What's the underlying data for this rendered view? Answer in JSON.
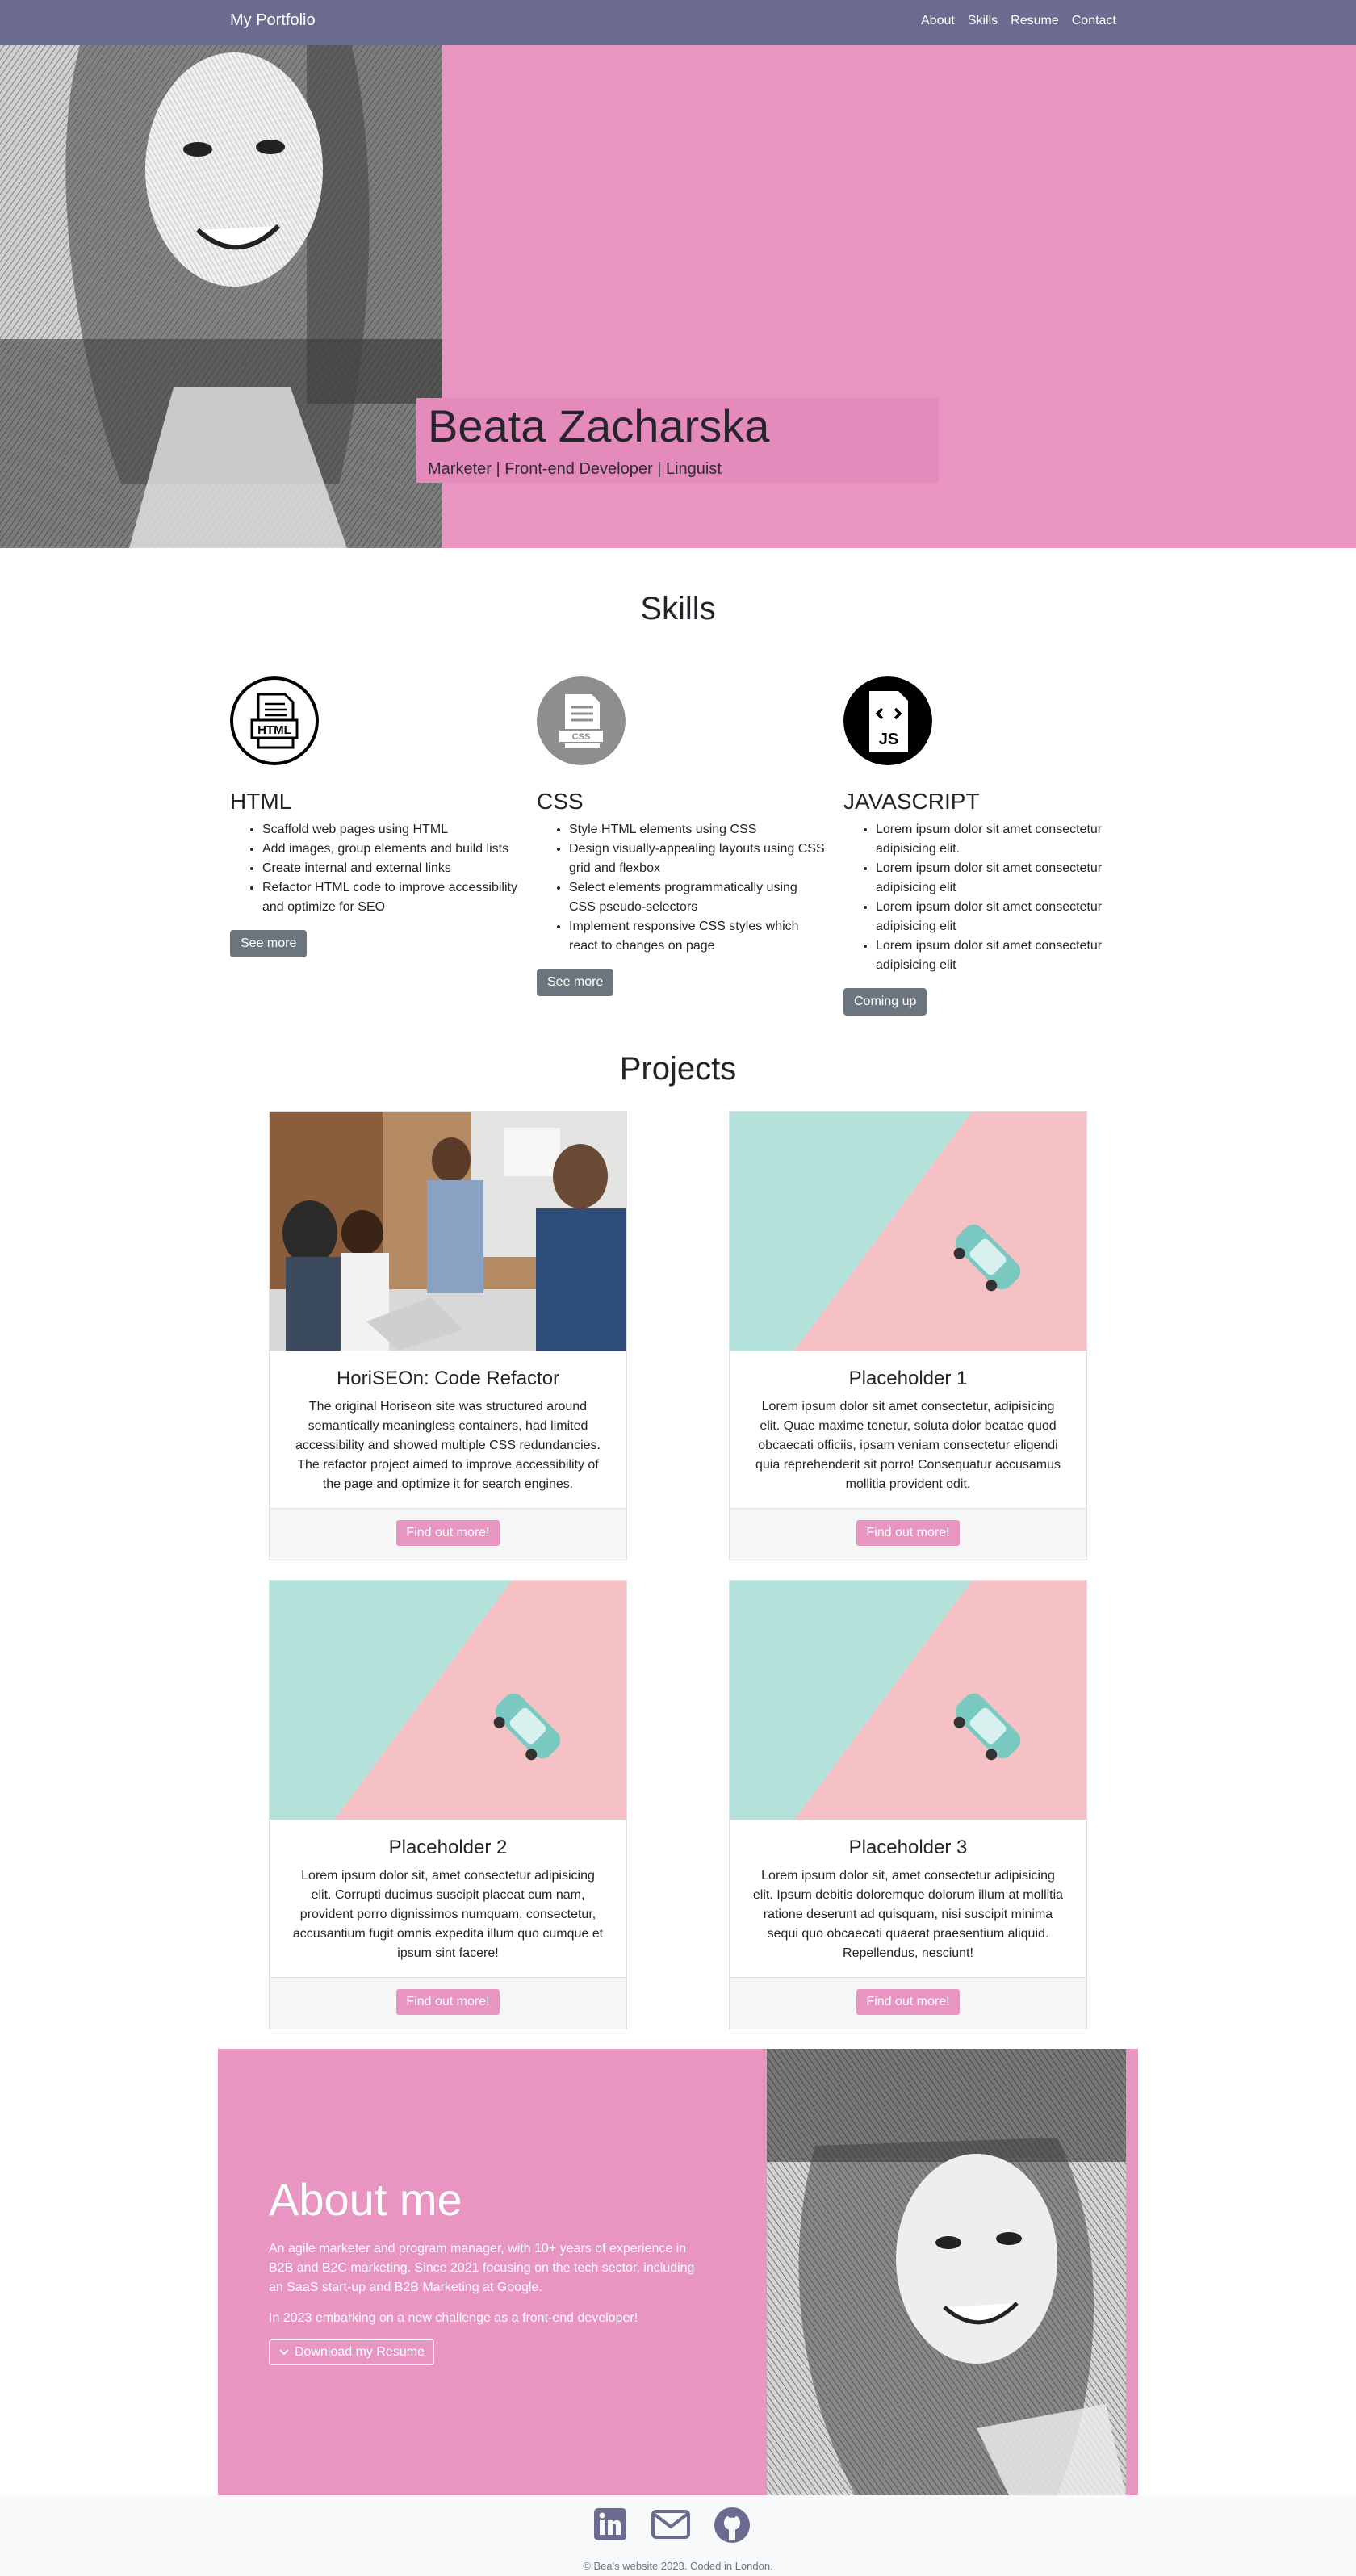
{
  "nav": {
    "brand": "My Portfolio",
    "links": [
      "About",
      "Skills",
      "Resume",
      "Contact"
    ]
  },
  "hero": {
    "name": "Beata Zacharska",
    "subtitle": "Marketer | Front-end Developer | Linguist"
  },
  "skills": {
    "title": "Skills",
    "items": [
      {
        "icon": "html-file-icon",
        "title": "HTML",
        "bullets": [
          "Scaffold web pages using HTML",
          "Add images, group elements and build lists",
          "Create internal and external links",
          "Refactor HTML code to improve accessibility and optimize for SEO"
        ],
        "button": "See more"
      },
      {
        "icon": "css-file-icon",
        "title": "CSS",
        "bullets": [
          "Style HTML elements using CSS",
          "Design visually-appealing layouts using CSS grid and flexbox",
          "Select elements programmatically using CSS pseudo-selectors",
          "Implement responsive CSS styles which react to changes on page"
        ],
        "button": "See more"
      },
      {
        "icon": "js-file-icon",
        "title": "JAVASCRIPT",
        "bullets": [
          "Lorem ipsum dolor sit amet consectetur adipisicing elit.",
          "Lorem ipsum dolor sit amet consectetur adipisicing elit",
          "Lorem ipsum dolor sit amet consectetur adipisicing elit",
          "Lorem ipsum dolor sit amet consectetur adipisicing elit"
        ],
        "button": "Coming up"
      }
    ]
  },
  "projects": {
    "title": "Projects",
    "items": [
      {
        "image": "team-meeting-photo",
        "title": "HoriSEOn: Code Refactor",
        "text": "The original Horiseon site was structured around semantically meaningless containers, had limited accessibility and showed multiple CSS redundancies. The refactor project aimed to improve accessibility of the page and optimize it for search engines.",
        "button": "Find out more!"
      },
      {
        "image": "toy-car-placeholder",
        "title": "Placeholder 1",
        "text": "Lorem ipsum dolor sit amet consectetur, adipisicing elit. Quae maxime tenetur, soluta dolor beatae quod obcaecati officiis, ipsam veniam consectetur eligendi quia reprehenderit sit porro! Consequatur accusamus mollitia provident odit.",
        "button": "Find out more!"
      },
      {
        "image": "toy-car-placeholder",
        "title": "Placeholder 2",
        "text": "Lorem ipsum dolor sit, amet consectetur adipisicing elit. Corrupti ducimus suscipit placeat cum nam, provident porro dignissimos numquam, consectetur, accusantium fugit omnis expedita illum quo cumque et ipsum sint facere!",
        "button": "Find out more!"
      },
      {
        "image": "toy-car-placeholder",
        "title": "Placeholder 3",
        "text": "Lorem ipsum dolor sit, amet consectetur adipisicing elit. Ipsum debitis doloremque dolorum illum at mollitia ratione deserunt ad quisquam, nisi suscipit minima sequi quo obcaecati quaerat praesentium aliquid. Repellendus, nesciunt!",
        "button": "Find out more!"
      }
    ]
  },
  "about": {
    "title": "About me",
    "text": "An agile marketer and program manager, with 10+ years of experience in B2B and B2C marketing. Since 2021 focusing on the tech sector, including an SaaS start-up and B2B Marketing at Google.",
    "text2": "In 2023 embarking on a new challenge as a front-end developer!",
    "button": "Download my Resume"
  },
  "footer": {
    "social": [
      "linkedin-icon",
      "email-icon",
      "github-icon"
    ],
    "copyright": "© Bea's website 2023. Coded in London."
  },
  "colors": {
    "brand_pink": "#e895c2",
    "navbar": "#6a6b8f",
    "button_grey": "#6c757d"
  }
}
